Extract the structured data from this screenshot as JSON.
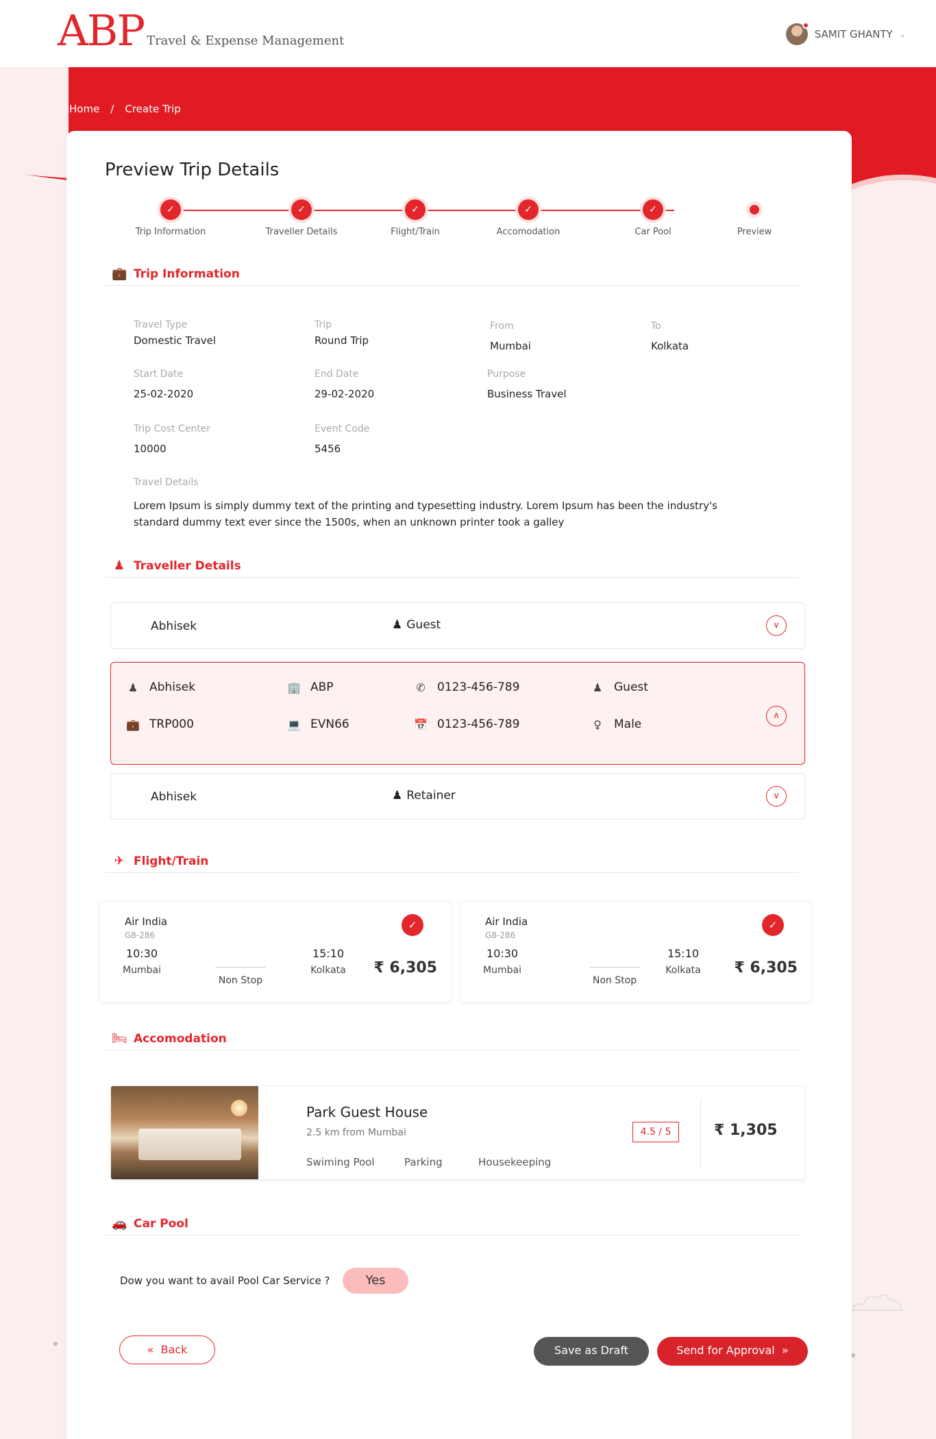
{
  "header": {
    "logo_main": "ABP",
    "logo_sub": "Travel & Expense Management",
    "user_name": "SAMIT GHANTY"
  },
  "breadcrumb": {
    "home": "Home",
    "sep": "/",
    "current": "Create Trip"
  },
  "page_title": "Preview Trip Details",
  "steps": [
    {
      "label": "Trip Information"
    },
    {
      "label": "Traveller Details"
    },
    {
      "label": "Flight/Train"
    },
    {
      "label": "Accomodation"
    },
    {
      "label": "Car Pool"
    },
    {
      "label": "Preview"
    }
  ],
  "trip_info": {
    "title": "Trip Information",
    "travel_type": {
      "label": "Travel Type",
      "value": "Domestic Travel"
    },
    "trip": {
      "label": "Trip",
      "value": "Round Trip"
    },
    "from": {
      "label": "From",
      "value": "Mumbai"
    },
    "to": {
      "label": "To",
      "value": "Kolkata"
    },
    "start_date": {
      "label": "Start Date",
      "value": "25-02-2020"
    },
    "end_date": {
      "label": "End Date",
      "value": "29-02-2020"
    },
    "purpose": {
      "label": "Purpose",
      "value": "Business Travel"
    },
    "cost_center": {
      "label": "Trip Cost Center",
      "value": "10000"
    },
    "event_code": {
      "label": "Event Code",
      "value": "5456"
    },
    "details": {
      "label": "Travel Details",
      "value": "Lorem Ipsum is simply dummy text of the printing and typesetting industry. Lorem Ipsum has been the industry's standard dummy text ever since the 1500s, when an unknown printer took a galley"
    }
  },
  "traveller": {
    "title": "Traveller Details",
    "rows": [
      {
        "name": "Abhisek",
        "role": "Guest",
        "badge": "G"
      },
      {
        "name": "Abhisek",
        "role": "Retainer",
        "badge": "R"
      }
    ],
    "expanded": {
      "name": "Abhisek",
      "company": "ABP",
      "phone": "0123-456-789",
      "role": "Guest",
      "badge": "G",
      "trip_id": "TRP000",
      "event": "EVN66",
      "alt_phone": "0123-456-789",
      "gender": "Male"
    }
  },
  "flights": {
    "title": "Flight/Train",
    "items": [
      {
        "airline": "Air India",
        "code": "G8-286",
        "dep_time": "10:30",
        "dep_city": "Mumbai",
        "stops": "Non Stop",
        "arr_time": "15:10",
        "arr_city": "Kolkata",
        "price": "₹ 6,305"
      },
      {
        "airline": "Air India",
        "code": "G8-286",
        "dep_time": "10:30",
        "dep_city": "Mumbai",
        "stops": "Non Stop",
        "arr_time": "15:10",
        "arr_city": "Kolkata",
        "price": "₹ 6,305"
      }
    ]
  },
  "hotel": {
    "title": "Accomodation",
    "name": "Park Guest House",
    "distance": "2.5 km from Mumbai",
    "amenities": [
      "Swiming Pool",
      "Parking",
      "Housekeeping"
    ],
    "rating": "4.5 / 5",
    "price": "₹ 1,305"
  },
  "carpool": {
    "title": "Car Pool",
    "question": "Dow you want to avail Pool Car Service ?",
    "answer": "Yes"
  },
  "actions": {
    "back": "Back",
    "draft": "Save as Draft",
    "send": "Send for Approval"
  },
  "colors": {
    "accent": "#e3262b",
    "band": "#e01b24",
    "bg": "#fbeeee"
  }
}
